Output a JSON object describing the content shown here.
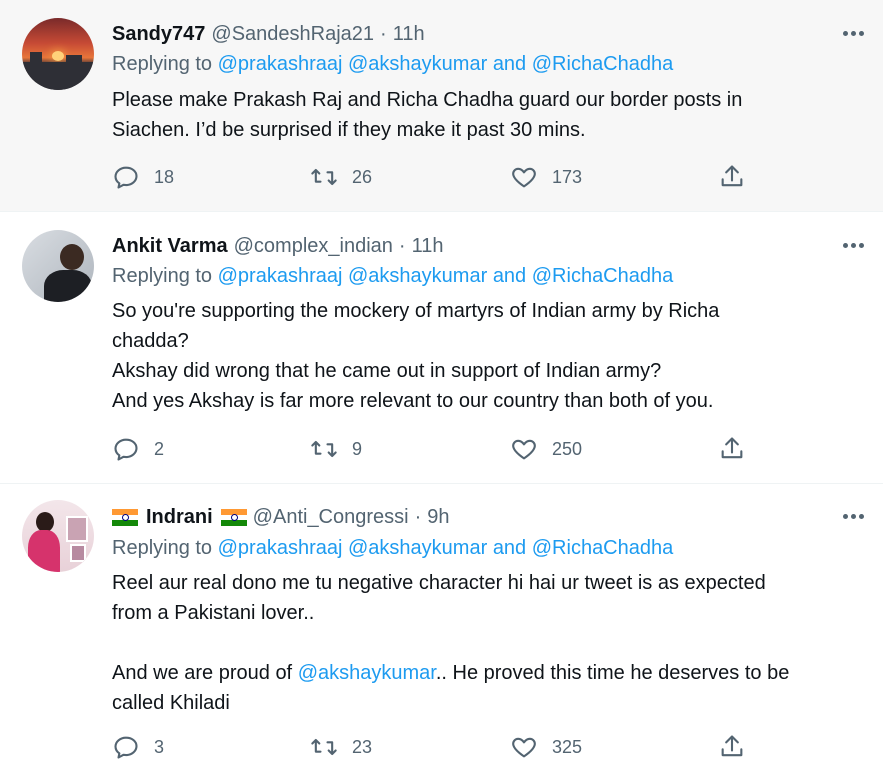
{
  "tweets": [
    {
      "name": "Sandy747",
      "handle": "@SandeshRaja21",
      "separator": "·",
      "time": "11h",
      "replying_prefix": "Replying to",
      "replying_mentions": [
        "@prakashraaj",
        "@akshaykumar",
        "and",
        "@RichaChadha"
      ],
      "lines": [
        "Please make Prakash Raj and Richa Chadha guard our border posts in",
        "Siachen. I’d be surprised if they make it past 30 mins."
      ],
      "stats": {
        "replies": "18",
        "retweets": "26",
        "likes": "173"
      }
    },
    {
      "name": "Ankit Varma",
      "handle": "@complex_indian",
      "separator": "·",
      "time": "11h",
      "replying_prefix": "Replying to",
      "replying_mentions": [
        "@prakashraaj",
        "@akshaykumar",
        "and",
        "@RichaChadha"
      ],
      "lines": [
        "So you're supporting the mockery of martyrs of Indian army by Richa",
        "chadda?",
        "Akshay did wrong that he came out in support of Indian army?",
        "And yes Akshay is far more relevant to our country than both of you."
      ],
      "stats": {
        "replies": "2",
        "retweets": "9",
        "likes": "250"
      }
    },
    {
      "name": "Indrani",
      "handle": "@Anti_Congressi",
      "separator": "·",
      "time": "9h",
      "replying_prefix": "Replying to",
      "replying_mentions": [
        "@prakashraaj",
        "@akshaykumar",
        "and",
        "@RichaChadha"
      ],
      "lines": [
        "Reel aur real dono me tu negative character hi hai ur tweet is as expected",
        "from a Pakistani lover.."
      ],
      "line3_before": "And we are proud of ",
      "line3_mention": "@akshaykumar",
      "line3_after": ".. He proved this time he deserves to be",
      "line4": "called Khiladi",
      "stats": {
        "replies": "3",
        "retweets": "23",
        "likes": "325"
      }
    }
  ],
  "icons": {
    "reply": "reply-icon",
    "retweet": "retweet-icon",
    "like": "heart-icon",
    "share": "share-icon",
    "more": "more-icon",
    "flag": "india-flag-icon"
  },
  "colors": {
    "link": "#1d9bf0",
    "secondary_text": "#536471",
    "highlight_bg": "#f7f7f7"
  }
}
